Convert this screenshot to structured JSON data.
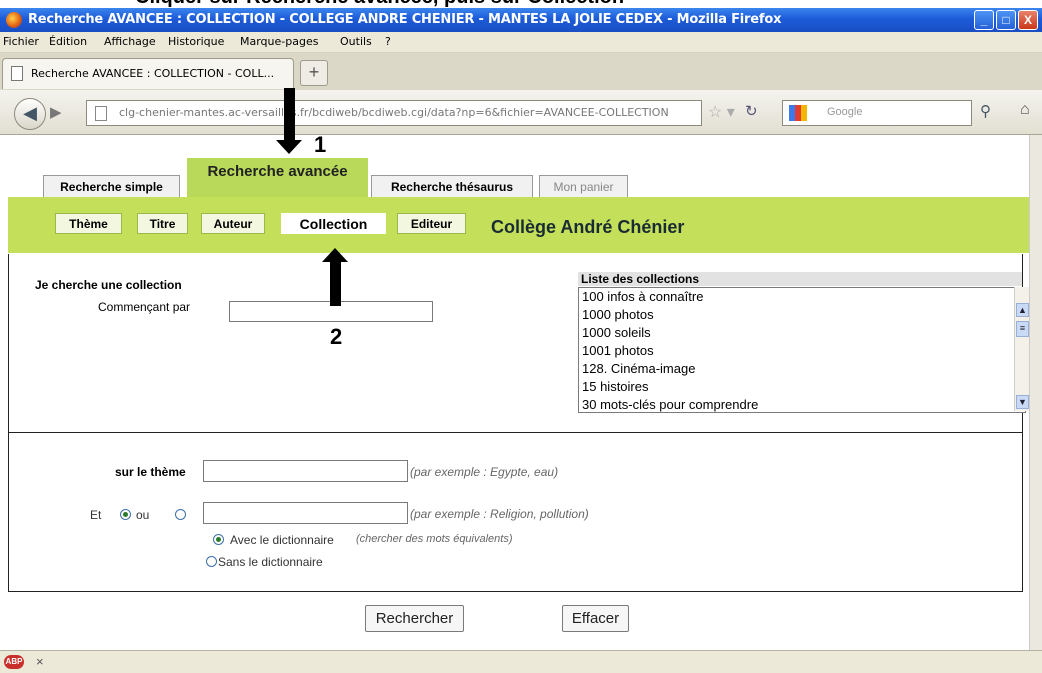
{
  "caption": "Cliquer sur Recherche avancée, puis sur Collection",
  "window": {
    "title": "Recherche AVANCEE : COLLECTION - COLLEGE ANDRE CHENIER - MANTES LA JOLIE CEDEX - Mozilla Firefox",
    "minimize": "_",
    "maximize": "□",
    "close": "X"
  },
  "menu": [
    "Fichier",
    "Édition",
    "Affichage",
    "Historique",
    "Marque-pages",
    "Outils",
    "?"
  ],
  "browser_tab": {
    "label": "Recherche AVANCEE : COLLECTION - COLL...",
    "new_tab": "+"
  },
  "nav": {
    "url": "clg-chenier-mantes.ac-versailles.fr/bcdiweb/bcdiweb.cgi/data?np=6&fichier=AVANCEE-COLLECTION",
    "search_placeholder": "Google"
  },
  "site_tabs": {
    "simple": "Recherche simple",
    "avancee": "Recherche avancée",
    "thesaurus": "Recherche thésaurus",
    "panier": "Mon panier"
  },
  "sub_nav": [
    "Thème",
    "Titre",
    "Auteur",
    "Collection",
    "Editeur"
  ],
  "college_name": "Collège André Chénier",
  "search": {
    "heading": "Je cherche une collection",
    "starts_with_label": "Commençant par",
    "starts_with_value": ""
  },
  "collections": {
    "title": "Liste des collections",
    "items": [
      "100 infos à connaître",
      "1000 photos",
      "1000 soleils",
      "1001 photos",
      "128. Cinéma-image",
      "15 histoires",
      "30 mots-clés pour comprendre"
    ]
  },
  "theme": {
    "label": "sur le thème",
    "hint": "(par exemple : Egypte, eau)",
    "et_label": "Et",
    "ou_label": "ou",
    "hint2": "(par exemple : Religion, pollution)",
    "avec_label": "Avec le dictionnaire",
    "avec_hint": "(chercher des mots équivalents)",
    "sans_label": "Sans le dictionnaire"
  },
  "buttons": {
    "search": "Rechercher",
    "clear": "Effacer"
  },
  "annotations": {
    "arrow1": "1",
    "arrow2": "2"
  },
  "status": {
    "abp": "ABP",
    "close": "×"
  }
}
